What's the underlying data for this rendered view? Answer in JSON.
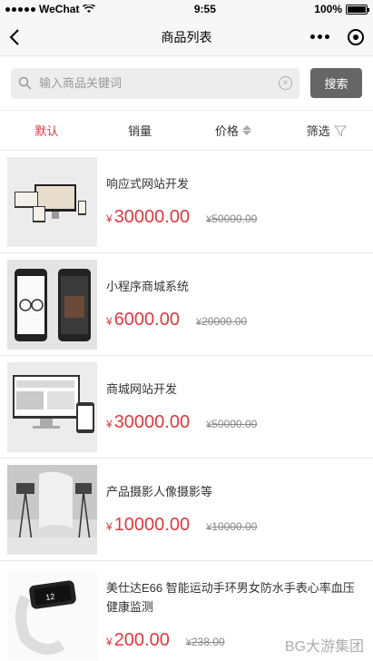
{
  "status_bar": {
    "carrier": "WeChat",
    "time": "9:55",
    "battery": "100%"
  },
  "nav": {
    "title": "商品列表"
  },
  "search": {
    "placeholder": "输入商品关键词",
    "button_label": "搜索"
  },
  "filters": [
    {
      "label": "默认"
    },
    {
      "label": "销量"
    },
    {
      "label": "价格"
    },
    {
      "label": "筛选"
    }
  ],
  "currency_symbol": "¥",
  "products": [
    {
      "name": "响应式网站开发",
      "price": "30000.00",
      "orig_price": "50000.00"
    },
    {
      "name": "小程序商城系统",
      "price": "6000.00",
      "orig_price": "20000.00"
    },
    {
      "name": "商城网站开发",
      "price": "30000.00",
      "orig_price": "50000.00"
    },
    {
      "name": "产品摄影人像摄影等",
      "price": "10000.00",
      "orig_price": "10000.00"
    },
    {
      "name": "美仕达E66 智能运动手环男女防水手表心率血压健康监测",
      "price": "200.00",
      "orig_price": "238.00"
    }
  ],
  "watermark": "BG大游集团",
  "colors": {
    "accent": "#e0393e",
    "search_button": "#666666"
  }
}
